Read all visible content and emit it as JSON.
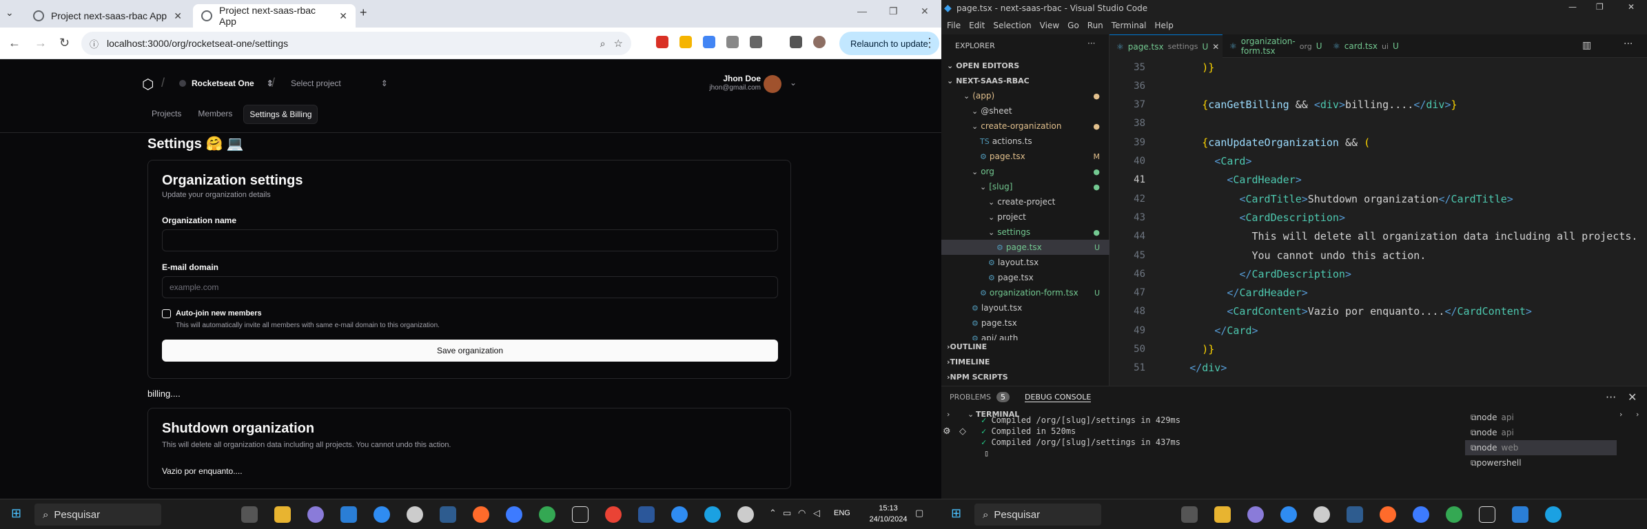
{
  "browser": {
    "tabs": [
      {
        "label": "Project next-saas-rbac App",
        "active": false
      },
      {
        "label": "Project next-saas-rbac App",
        "active": true
      }
    ],
    "url": "localhost:3000/org/rocketseat-one/settings",
    "relaunch_label": "Relaunch to update"
  },
  "app": {
    "org_name": "Rocketseat One",
    "project_placeholder": "Select project",
    "user_name": "Jhon Doe",
    "user_email": "jhon@gmail.com",
    "nav": [
      "Projects",
      "Members",
      "Settings & Billing"
    ],
    "page_title": "Settings 🤗 💻",
    "org_settings": {
      "title": "Organization settings",
      "description": "Update your organization details",
      "name_label": "Organization name",
      "name_value": "",
      "domain_label": "E-mail domain",
      "domain_placeholder": "example.com",
      "autojoin_label": "Auto-join new members",
      "autojoin_help": "This will automatically invite all members with same e-mail domain to this organization.",
      "save_label": "Save organization"
    },
    "billing_text": "billing....",
    "shutdown": {
      "title": "Shutdown organization",
      "description": "This will delete all organization data including all projects. You cannot undo this action.",
      "content": "Vazio por enquanto...."
    }
  },
  "vscode": {
    "window_title": "page.tsx - next-saas-rbac - Visual Studio Code",
    "menu": [
      "File",
      "Edit",
      "Selection",
      "View",
      "Go",
      "Run",
      "Terminal",
      "Help"
    ],
    "explorer_title": "EXPLORER",
    "tree": [
      {
        "label": "OPEN EDITORS",
        "depth": 0,
        "section": true
      },
      {
        "label": "NEXT-SAAS-RBAC",
        "depth": 0,
        "section": true
      },
      {
        "label": "(app)",
        "depth": 2,
        "folder": true,
        "color": "#e2c08d",
        "badge": "●"
      },
      {
        "label": "@sheet",
        "depth": 3,
        "folder": true
      },
      {
        "label": "create-organization",
        "depth": 3,
        "folder": true,
        "color": "#e2c08d",
        "badge": "●"
      },
      {
        "label": "actions.ts",
        "depth": 4,
        "icon": "TS"
      },
      {
        "label": "page.tsx",
        "depth": 4,
        "color": "#e2c08d",
        "badge": "M"
      },
      {
        "label": "org",
        "depth": 3,
        "folder": true,
        "color": "#73c991",
        "badge": "●"
      },
      {
        "label": "[slug]",
        "depth": 4,
        "folder": true,
        "color": "#73c991",
        "badge": "●"
      },
      {
        "label": "create-project",
        "depth": 5,
        "folder": true
      },
      {
        "label": "project",
        "depth": 5,
        "folder": true
      },
      {
        "label": "settings",
        "depth": 5,
        "folder": true,
        "color": "#73c991",
        "badge": "●"
      },
      {
        "label": "page.tsx",
        "depth": 6,
        "color": "#73c991",
        "badge": "U",
        "selected": true
      },
      {
        "label": "layout.tsx",
        "depth": 5
      },
      {
        "label": "page.tsx",
        "depth": 5
      },
      {
        "label": "organization-form.tsx",
        "depth": 4,
        "color": "#73c991",
        "badge": "U"
      },
      {
        "label": "layout.tsx",
        "depth": 3
      },
      {
        "label": "page.tsx",
        "depth": 3
      },
      {
        "label": "api/ auth",
        "depth": 3
      }
    ],
    "bottom_sections": [
      "OUTLINE",
      "TIMELINE",
      "NPM SCRIPTS"
    ],
    "editor_tabs": [
      {
        "name": "page.tsx",
        "hint": "settings",
        "badge": "U",
        "active": true
      },
      {
        "name": "organization-form.tsx",
        "hint": "org",
        "badge": "U",
        "active": false
      },
      {
        "name": "card.tsx",
        "hint": "ui",
        "badge": "U",
        "active": false
      }
    ],
    "code": [
      {
        "n": "35",
        "text": "        )}"
      },
      {
        "n": "36",
        "text": ""
      },
      {
        "n": "37",
        "text": "        {canGetBilling && <div>billing....</div>}"
      },
      {
        "n": "38",
        "text": ""
      },
      {
        "n": "39",
        "text": "        {canUpdateOrganization && ("
      },
      {
        "n": "40",
        "text": "          <Card>"
      },
      {
        "n": "41",
        "text": "            <CardHeader>"
      },
      {
        "n": "42",
        "text": "              <CardTitle>Shutdown organization</CardTitle>"
      },
      {
        "n": "43",
        "text": "              <CardDescription>"
      },
      {
        "n": "44",
        "text": "                This will delete all organization data including all projects."
      },
      {
        "n": "45",
        "text": "                You cannot undo this action."
      },
      {
        "n": "46",
        "text": "              </CardDescription>"
      },
      {
        "n": "47",
        "text": "            </CardHeader>"
      },
      {
        "n": "48",
        "text": "            <CardContent>Vazio por enquanto....</CardContent>"
      },
      {
        "n": "49",
        "text": "          </Card>"
      },
      {
        "n": "50",
        "text": "        )}"
      },
      {
        "n": "51",
        "text": "      </div>"
      }
    ],
    "current_line": "41",
    "panel_tabs": {
      "problems": "PROBLEMS",
      "problems_count": "5",
      "debug": "DEBUG CONSOLE"
    },
    "terminal_title": "TERMINAL",
    "terminal_lines": [
      "Compiled /org/[slug]/settings in 429ms",
      "Compiled in 520ms",
      "Compiled /org/[slug]/settings in 437ms"
    ],
    "terminal_list": [
      {
        "name": "node",
        "hint": "api"
      },
      {
        "name": "node",
        "hint": "api"
      },
      {
        "name": "node",
        "hint": "web",
        "selected": true
      },
      {
        "name": "powershell",
        "hint": ""
      }
    ]
  },
  "taskbar": {
    "search_left": "Pesquisar",
    "search_right": "Pesquisar",
    "language": "ENG",
    "time": "15:13",
    "date": "24/10/2024"
  }
}
